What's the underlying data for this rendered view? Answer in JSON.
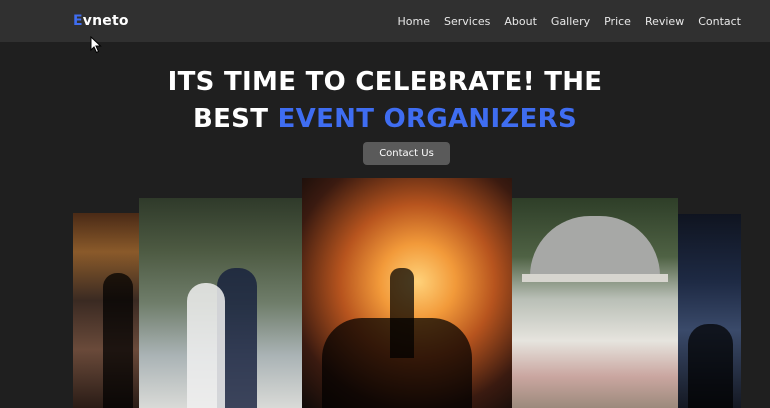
{
  "brand": {
    "logo_first": "E",
    "logo_rest": "vneto"
  },
  "nav": {
    "items": [
      {
        "label": "Home"
      },
      {
        "label": "Services"
      },
      {
        "label": "About"
      },
      {
        "label": "Gallery"
      },
      {
        "label": "Price"
      },
      {
        "label": "Review"
      },
      {
        "label": "Contact"
      }
    ]
  },
  "hero": {
    "line1": "ITS TIME TO CELEBRATE! THE",
    "line2_prefix": "BEST",
    "line2_accent": "EVENT ORGANIZERS",
    "cta_label": "Contact Us"
  },
  "colors": {
    "accent": "#3f6df1",
    "navbar": "#303030",
    "background": "#1f1f1f",
    "button": "#5a5a5a"
  },
  "gallery": {
    "images": [
      {
        "name": "party-confetti-photo"
      },
      {
        "name": "wedding-couple-photo"
      },
      {
        "name": "concert-crowd-photo"
      },
      {
        "name": "gazebo-venue-photo"
      },
      {
        "name": "nightclub-photo"
      }
    ]
  }
}
